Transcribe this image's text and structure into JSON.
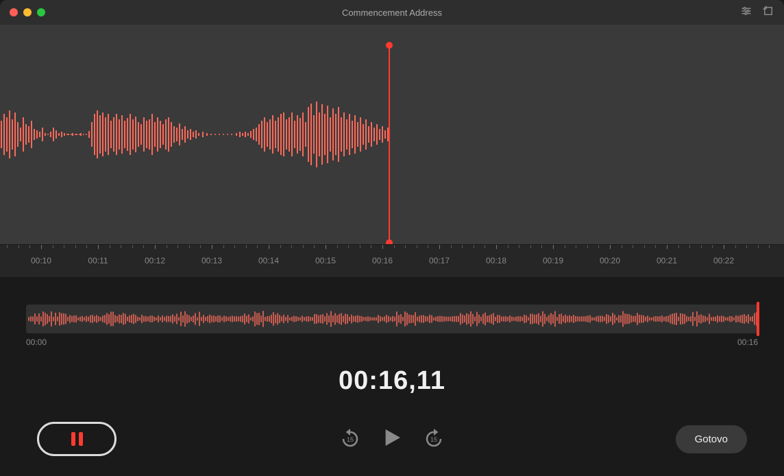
{
  "window": {
    "title": "Commencement Address"
  },
  "timeline": {
    "ticks": [
      "00:10",
      "00:11",
      "00:12",
      "00:13",
      "00:14",
      "00:15",
      "00:16",
      "00:17",
      "00:18",
      "00:19",
      "00:20",
      "00:21",
      "00:22"
    ]
  },
  "overview": {
    "start": "00:00",
    "end": "00:16"
  },
  "timer": {
    "display": "00:16,11"
  },
  "controls": {
    "done_label": "Gotovo",
    "skip_seconds": "15"
  },
  "colors": {
    "accent": "#ff3b30"
  }
}
